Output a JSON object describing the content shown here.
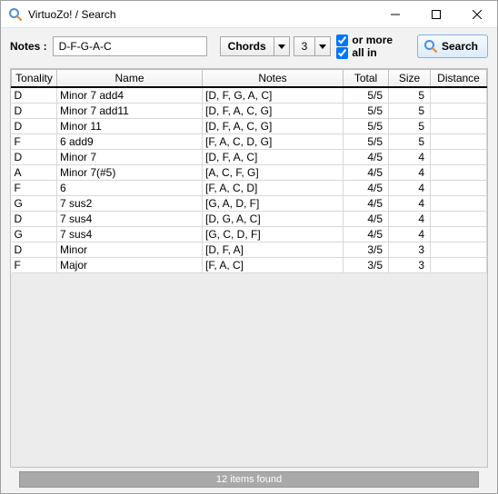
{
  "window": {
    "title": "VirtuoZo! / Search"
  },
  "toolbar": {
    "notes_label": "Notes :",
    "notes_value": "D-F-G-A-C",
    "type_label": "Chords",
    "count_label": "3",
    "or_more_label": "or more",
    "all_in_label": "all in",
    "or_more_checked": true,
    "all_in_checked": true,
    "search_label": "Search"
  },
  "columns": {
    "tonality": "Tonality",
    "name": "Name",
    "notes": "Notes",
    "total": "Total",
    "size": "Size",
    "distance": "Distance"
  },
  "rows": [
    {
      "tonality": "D",
      "name": "Minor 7 add4",
      "notes": "[D, F, G, A, C]",
      "total": "5/5",
      "size": "5",
      "distance": ""
    },
    {
      "tonality": "D",
      "name": "Minor 7 add11",
      "notes": "[D, F, A, C, G]",
      "total": "5/5",
      "size": "5",
      "distance": ""
    },
    {
      "tonality": "D",
      "name": "Minor 11",
      "notes": "[D, F, A, C, G]",
      "total": "5/5",
      "size": "5",
      "distance": ""
    },
    {
      "tonality": "F",
      "name": "6 add9",
      "notes": "[F, A, C, D, G]",
      "total": "5/5",
      "size": "5",
      "distance": ""
    },
    {
      "tonality": "D",
      "name": "Minor 7",
      "notes": "[D, F, A, C]",
      "total": "4/5",
      "size": "4",
      "distance": ""
    },
    {
      "tonality": "A",
      "name": "Minor 7(#5)",
      "notes": "[A, C, F, G]",
      "total": "4/5",
      "size": "4",
      "distance": ""
    },
    {
      "tonality": "F",
      "name": "6",
      "notes": "[F, A, C, D]",
      "total": "4/5",
      "size": "4",
      "distance": ""
    },
    {
      "tonality": "G",
      "name": "7 sus2",
      "notes": "[G, A, D, F]",
      "total": "4/5",
      "size": "4",
      "distance": ""
    },
    {
      "tonality": "D",
      "name": "7 sus4",
      "notes": "[D, G, A, C]",
      "total": "4/5",
      "size": "4",
      "distance": ""
    },
    {
      "tonality": "G",
      "name": "7 sus4",
      "notes": "[G, C, D, F]",
      "total": "4/5",
      "size": "4",
      "distance": ""
    },
    {
      "tonality": "D",
      "name": "Minor",
      "notes": "[D, F, A]",
      "total": "3/5",
      "size": "3",
      "distance": ""
    },
    {
      "tonality": "F",
      "name": "Major",
      "notes": "[F, A, C]",
      "total": "3/5",
      "size": "3",
      "distance": ""
    }
  ],
  "status": "12 items found"
}
